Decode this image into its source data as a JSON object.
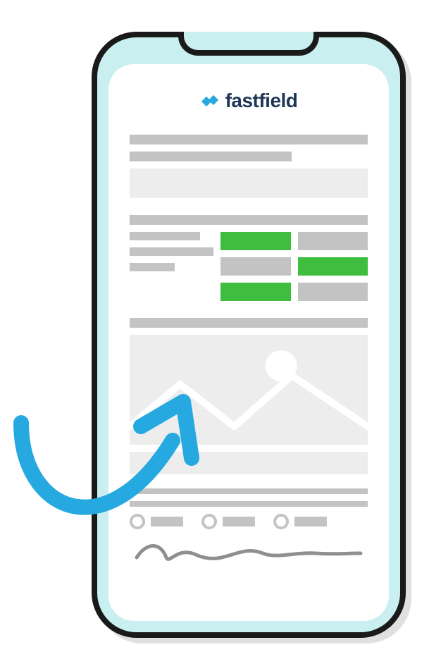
{
  "brand": {
    "name": "fastfield",
    "logo_color": "#26a9e0",
    "text_color": "#1e3756"
  },
  "colors": {
    "skeleton_grey": "#c3c3c3",
    "skeleton_light": "#ededed",
    "accent_green": "#3ebd3e",
    "phone_border": "#1a1a1a",
    "phone_fill": "#c9eff0",
    "arrow": "#26a9e0"
  },
  "form": {
    "header_bars": 2,
    "header_box": true,
    "section2_top_bar": true,
    "grid_rows": [
      {
        "label": true,
        "cells": [
          "green",
          "grey"
        ]
      },
      {
        "label": true,
        "cells": [
          "grey",
          "green"
        ]
      },
      {
        "label": false,
        "cells": [
          "green",
          "grey"
        ]
      }
    ],
    "section3_top_bar": true,
    "image_placeholder": true,
    "radios": 3,
    "signature": true
  }
}
